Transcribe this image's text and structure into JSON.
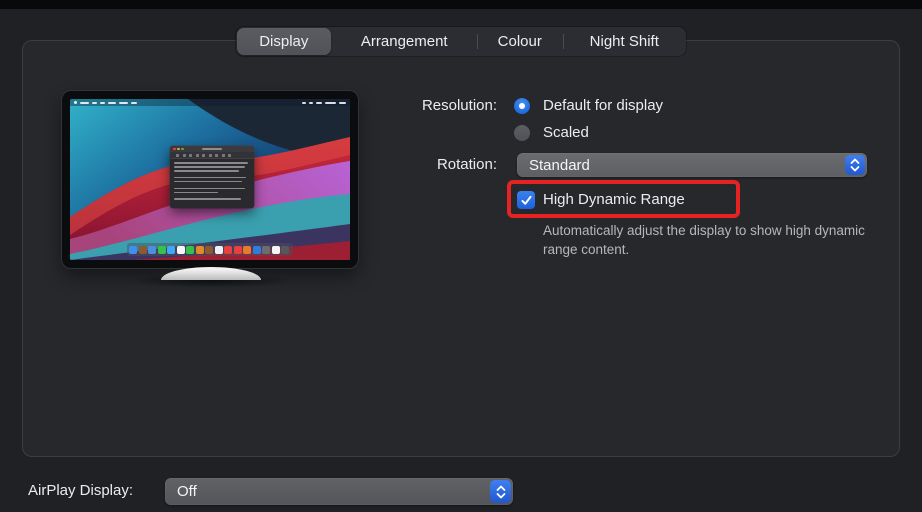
{
  "tabs": {
    "items": [
      {
        "label": "Display",
        "selected": true
      },
      {
        "label": "Arrangement",
        "selected": false
      },
      {
        "label": "Colour",
        "selected": false
      },
      {
        "label": "Night Shift",
        "selected": false
      }
    ]
  },
  "settings": {
    "resolution": {
      "label": "Resolution:",
      "options": [
        {
          "label": "Default for display",
          "selected": true
        },
        {
          "label": "Scaled",
          "selected": false
        }
      ]
    },
    "rotation": {
      "label": "Rotation:",
      "value": "Standard"
    },
    "hdr": {
      "label": "High Dynamic Range",
      "checked": true,
      "description": "Automatically adjust the display to show high dynamic range content."
    }
  },
  "airplay": {
    "label": "AirPlay Display:",
    "value": "Off"
  },
  "colors": {
    "accent_blue": "#1f6ce0",
    "highlight_red": "#e42322",
    "panel_bg": "#26282c",
    "window_bg": "#1f2125",
    "selected_tab": "#55565b"
  },
  "monitor_preview": {
    "description": "display-thumbnail-big-sur-wallpaper",
    "dock_colors": [
      "#3f8ef0",
      "#8a5a33",
      "#4a90e2",
      "#35c24a",
      "#3fa9f5",
      "#f5f6f7",
      "#35c24a",
      "#e08a2e",
      "#8a5a33",
      "#f0f0f2",
      "#e84040",
      "#e84040",
      "#e8792e",
      "#2f7de1",
      "#6a6d72",
      "#f5f5f5",
      "#55585e"
    ]
  }
}
